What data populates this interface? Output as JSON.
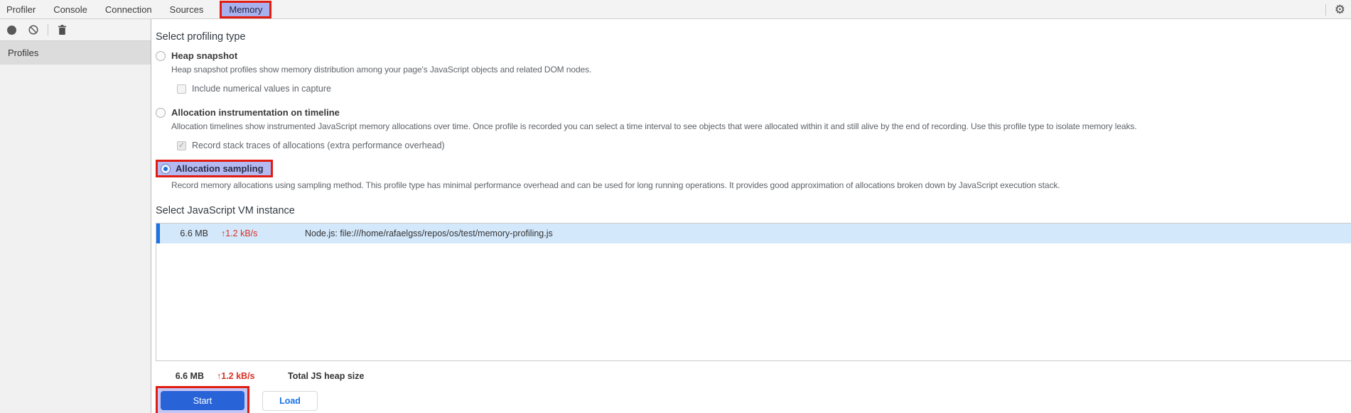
{
  "colors": {
    "annotation_red": "#e11d11",
    "highlight_lavender": "#a8b0ee",
    "selected_row_bg": "#d4e8fb",
    "selected_row_accent": "#1a73e8",
    "primary_button_blue": "#2864d8",
    "secondary_button_text_blue": "#1a73e8",
    "rate_red": "#d93025"
  },
  "tab_bar": {
    "tabs": [
      {
        "label": "Profiler",
        "selected": false
      },
      {
        "label": "Console",
        "selected": false
      },
      {
        "label": "Connection",
        "selected": false
      },
      {
        "label": "Sources",
        "selected": false
      },
      {
        "label": "Memory",
        "selected": true
      }
    ],
    "gear_icon": "settings-gear-icon"
  },
  "sidebar": {
    "toolbar_icons": [
      "record-icon",
      "clear-icon",
      "delete-icon"
    ],
    "profiles_header": "Profiles"
  },
  "main": {
    "profiling_type": {
      "heading": "Select profiling type",
      "options": [
        {
          "label": "Heap snapshot",
          "selected": false,
          "description": "Heap snapshot profiles show memory distribution among your page's JavaScript objects and related DOM nodes.",
          "sub_option": {
            "label": "Include numerical values in capture",
            "checked": false
          }
        },
        {
          "label": "Allocation instrumentation on timeline",
          "selected": false,
          "description": "Allocation timelines show instrumented JavaScript memory allocations over time. Once profile is recorded you can select a time interval to see objects that were allocated within it and still alive by the end of recording. Use this profile type to isolate memory leaks.",
          "sub_option": {
            "label": "Record stack traces of allocations (extra performance overhead)",
            "checked": true
          }
        },
        {
          "label": "Allocation sampling",
          "selected": true,
          "annotated": true,
          "description": "Record memory allocations using sampling method. This profile type has minimal performance overhead and can be used for long running operations. It provides good approximation of allocations broken down by JavaScript execution stack."
        }
      ]
    },
    "vm_instance": {
      "heading": "Select JavaScript VM instance",
      "rows": [
        {
          "size": "6.6 MB",
          "rate": "↑1.2 kB/s",
          "name": "Node.js: file:///home/rafaelgss/repos/os/test/memory-profiling.js",
          "selected": true
        }
      ],
      "summary": {
        "size": "6.6 MB",
        "rate": "↑1.2 kB/s",
        "label": "Total JS heap size"
      }
    },
    "actions": {
      "start_label": "Start",
      "load_label": "Load"
    },
    "checkmark_glyph": "✓"
  }
}
